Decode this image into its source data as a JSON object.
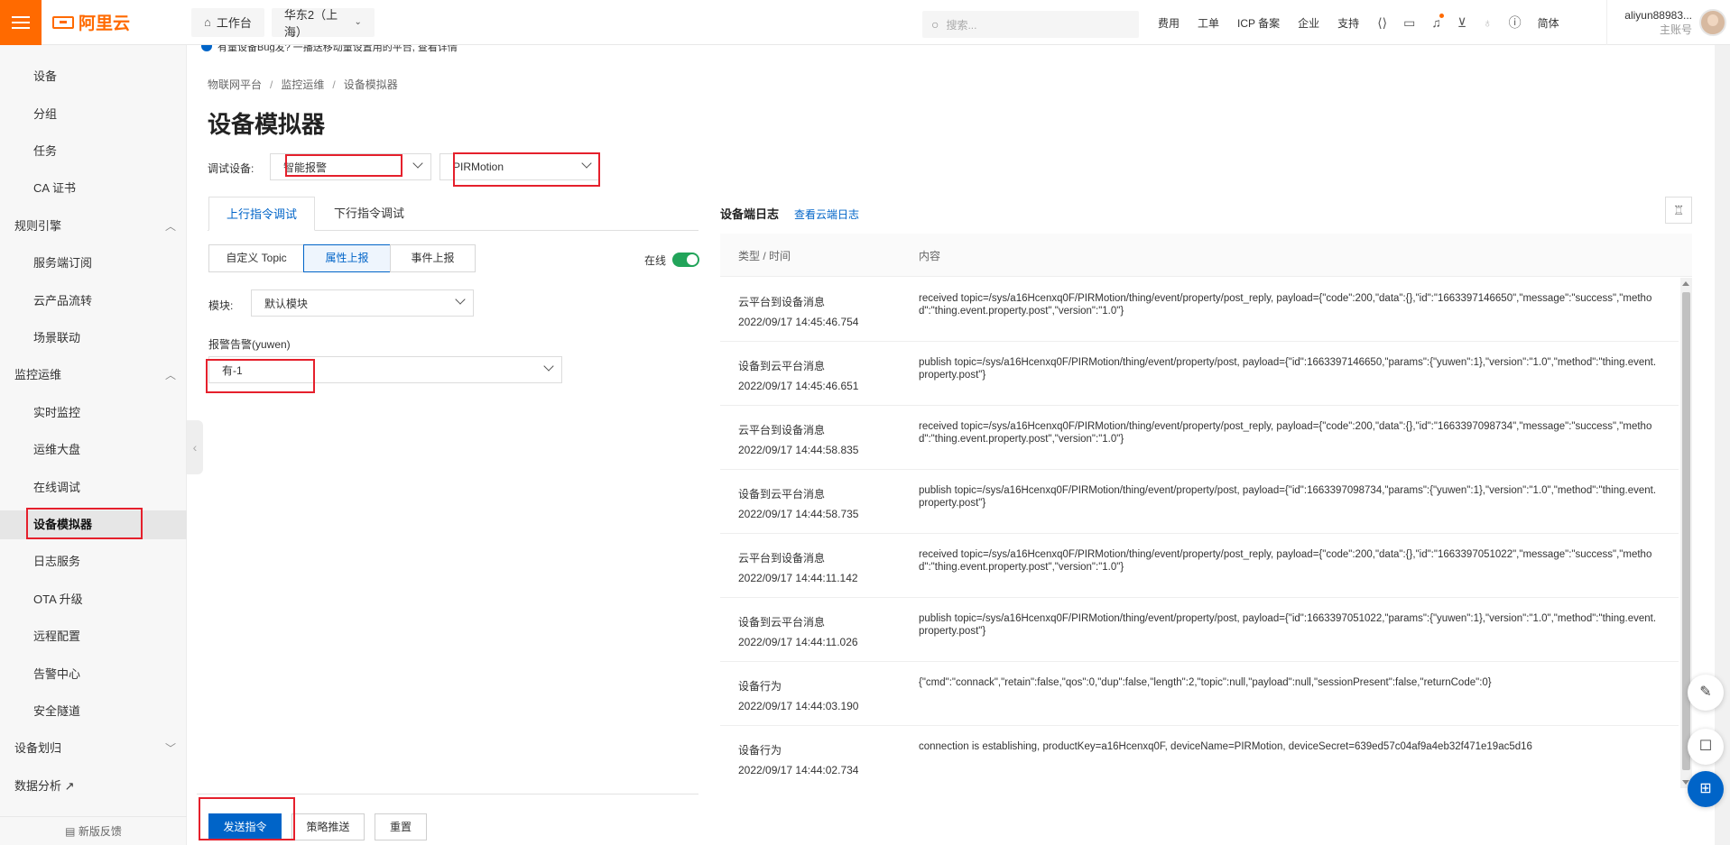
{
  "topbar": {
    "logo": "阿里云",
    "workbench": "工作台",
    "region": "华东2（上海）",
    "search_placeholder": "搜索...",
    "links": [
      "费用",
      "工单",
      "ICP 备案",
      "企业",
      "支持"
    ],
    "lang": "简体",
    "account_name": "aliyun88983...",
    "account_sub": "主账号"
  },
  "notice": {
    "text": "有量设备Bug发? 一播送移动量设置用的平台, 查看详情"
  },
  "sidebar": {
    "items": [
      {
        "label": "设备",
        "kind": "item",
        "top": 0
      },
      {
        "label": "分组",
        "kind": "item"
      },
      {
        "label": "任务",
        "kind": "item"
      },
      {
        "label": "CA 证书",
        "kind": "item"
      },
      {
        "label": "规则引擎",
        "kind": "group",
        "chevron": "up"
      },
      {
        "label": "服务端订阅",
        "kind": "item"
      },
      {
        "label": "云产品流转",
        "kind": "item"
      },
      {
        "label": "场景联动",
        "kind": "item"
      },
      {
        "label": "监控运维",
        "kind": "group",
        "chevron": "up"
      },
      {
        "label": "实时监控",
        "kind": "item"
      },
      {
        "label": "运维大盘",
        "kind": "item"
      },
      {
        "label": "在线调试",
        "kind": "item"
      },
      {
        "label": "设备模拟器",
        "kind": "item",
        "active": true
      },
      {
        "label": "日志服务",
        "kind": "item"
      },
      {
        "label": "OTA 升级",
        "kind": "item"
      },
      {
        "label": "远程配置",
        "kind": "item"
      },
      {
        "label": "告警中心",
        "kind": "item"
      },
      {
        "label": "安全隧道",
        "kind": "item"
      },
      {
        "label": "设备划归",
        "kind": "group",
        "chevron": "down"
      },
      {
        "label": "数据分析 ↗",
        "kind": "group"
      }
    ],
    "feedback": "新版反馈"
  },
  "breadcrumb": [
    "物联网平台",
    "监控运维",
    "设备模拟器"
  ],
  "page_title": "设备模拟器",
  "device_select": {
    "label": "调试设备:",
    "product": "智能报警",
    "device": "PIRMotion"
  },
  "tabs": [
    "上行指令调试",
    "下行指令调试"
  ],
  "segments": [
    "自定义 Topic",
    "属性上报",
    "事件上报"
  ],
  "online_label": "在线",
  "module": {
    "label": "模块:",
    "value": "默认模块"
  },
  "property": {
    "label": "报警告警(yuwen)",
    "value": "有-1"
  },
  "buttons": {
    "send": "发送指令",
    "strategy": "策略推送",
    "reset": "重置"
  },
  "log": {
    "title": "设备端日志",
    "link": "查看云端日志",
    "head_type": "类型 / 时间",
    "head_content": "内容",
    "rows": [
      {
        "type": "云平台到设备消息",
        "time": "2022/09/17 14:45:46.754",
        "content": "received topic=/sys/a16Hcenxq0F/PIRMotion/thing/event/property/post_reply, payload={\"code\":200,\"data\":{},\"id\":\"1663397146650\",\"message\":\"success\",\"method\":\"thing.event.property.post\",\"version\":\"1.0\"}"
      },
      {
        "type": "设备到云平台消息",
        "time": "2022/09/17 14:45:46.651",
        "content": "publish topic=/sys/a16Hcenxq0F/PIRMotion/thing/event/property/post, payload={\"id\":1663397146650,\"params\":{\"yuwen\":1},\"version\":\"1.0\",\"method\":\"thing.event.property.post\"}"
      },
      {
        "type": "云平台到设备消息",
        "time": "2022/09/17 14:44:58.835",
        "content": "received topic=/sys/a16Hcenxq0F/PIRMotion/thing/event/property/post_reply, payload={\"code\":200,\"data\":{},\"id\":\"1663397098734\",\"message\":\"success\",\"method\":\"thing.event.property.post\",\"version\":\"1.0\"}"
      },
      {
        "type": "设备到云平台消息",
        "time": "2022/09/17 14:44:58.735",
        "content": "publish topic=/sys/a16Hcenxq0F/PIRMotion/thing/event/property/post, payload={\"id\":1663397098734,\"params\":{\"yuwen\":1},\"version\":\"1.0\",\"method\":\"thing.event.property.post\"}"
      },
      {
        "type": "云平台到设备消息",
        "time": "2022/09/17 14:44:11.142",
        "content": "received topic=/sys/a16Hcenxq0F/PIRMotion/thing/event/property/post_reply, payload={\"code\":200,\"data\":{},\"id\":\"1663397051022\",\"message\":\"success\",\"method\":\"thing.event.property.post\",\"version\":\"1.0\"}"
      },
      {
        "type": "设备到云平台消息",
        "time": "2022/09/17 14:44:11.026",
        "content": "publish topic=/sys/a16Hcenxq0F/PIRMotion/thing/event/property/post, payload={\"id\":1663397051022,\"params\":{\"yuwen\":1},\"version\":\"1.0\",\"method\":\"thing.event.property.post\"}"
      },
      {
        "type": "设备行为",
        "time": "2022/09/17 14:44:03.190",
        "content": "{\"cmd\":\"connack\",\"retain\":false,\"qos\":0,\"dup\":false,\"length\":2,\"topic\":null,\"payload\":null,\"sessionPresent\":false,\"returnCode\":0}"
      },
      {
        "type": "设备行为",
        "time": "2022/09/17 14:44:02.734",
        "content": "connection is establishing, productKey=a16Hcenxq0F, deviceName=PIRMotion, deviceSecret=639ed57c04af9a4eb32f471e19ac5d16"
      }
    ]
  }
}
